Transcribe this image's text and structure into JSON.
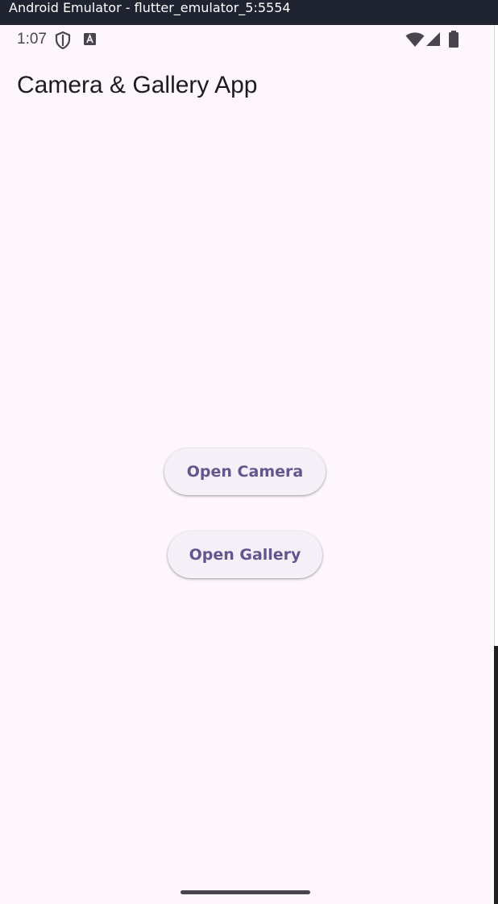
{
  "window": {
    "title": "Android Emulator - flutter_emulator_5:5554"
  },
  "statusbar": {
    "time": "1:07",
    "icons": [
      "shield-icon",
      "a-badge-icon",
      "wifi-icon",
      "signal-icon",
      "battery-icon"
    ]
  },
  "appbar": {
    "title": "Camera & Gallery App"
  },
  "actions": {
    "camera_label": "Open Camera",
    "gallery_label": "Open Gallery"
  },
  "colors": {
    "background": "#fdf7fd",
    "button_bg": "#f5eff7",
    "button_text": "#65558f",
    "title_text": "#1d1b20",
    "titlebar_bg": "#1f2430"
  }
}
